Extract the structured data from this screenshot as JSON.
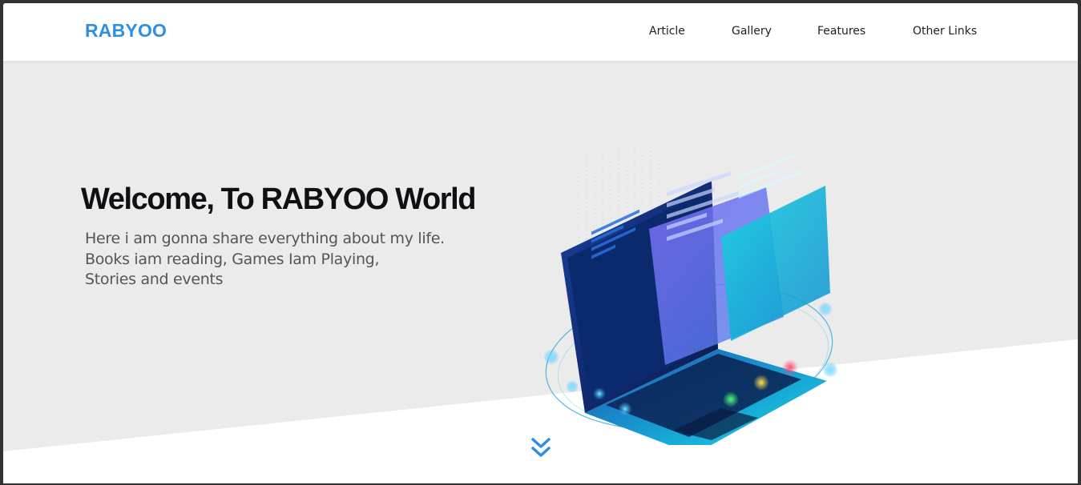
{
  "brand": {
    "name": "RABYOO",
    "color": "#2f8fe0"
  },
  "nav": {
    "items": [
      {
        "label": "Article"
      },
      {
        "label": "Gallery"
      },
      {
        "label": "Features"
      },
      {
        "label": "Other Links"
      }
    ]
  },
  "hero": {
    "title": "Welcome, To RABYOO World",
    "lines": [
      "Here i am gonna share everything about my life.",
      "Books iam reading, Games Iam Playing,",
      "Stories and events"
    ],
    "scroll_icon": "double-chevron-down-icon",
    "illustration_icon": "laptop-illustration"
  }
}
